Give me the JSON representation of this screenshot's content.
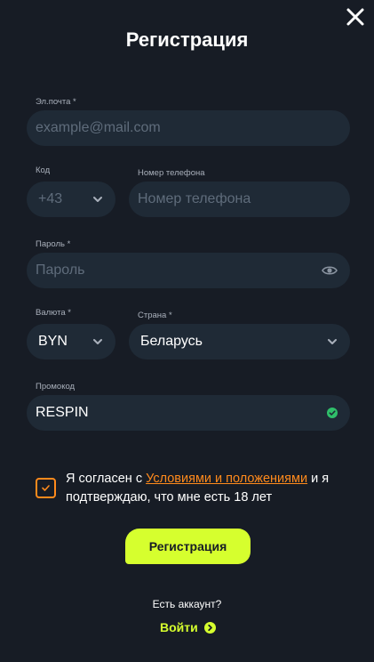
{
  "header": {
    "title": "Регистрация",
    "close_icon": "close-icon"
  },
  "email": {
    "label": "Эл.почта *",
    "placeholder": "example@mail.com"
  },
  "code": {
    "label": "Код",
    "value": "+43"
  },
  "phone": {
    "label": "Номер телефона",
    "placeholder": "Номер телефона"
  },
  "password": {
    "label": "Пароль *",
    "placeholder": "Пароль",
    "icon": "eye-icon"
  },
  "currency": {
    "label": "Валюта *",
    "value": "BYN"
  },
  "country": {
    "label": "Страна *",
    "value": "Беларусь"
  },
  "promo": {
    "label": "Промокод",
    "value": "RESPIN",
    "status_icon": "check-circle-icon"
  },
  "agreement": {
    "checked": true,
    "text_before": "Я согласен с ",
    "link": "Условиями и положениями",
    "text_after": " и я подтверждаю, что мне есть 18 лет"
  },
  "submit_label": "Регистрация",
  "footer": {
    "have_account": "Есть аккаунт?",
    "login_label": "Войти"
  },
  "colors": {
    "background": "#171c25",
    "field": "#1f2a36",
    "accent": "#d6ff2e",
    "link": "#ff8a1c",
    "success": "#2fbf6a"
  }
}
